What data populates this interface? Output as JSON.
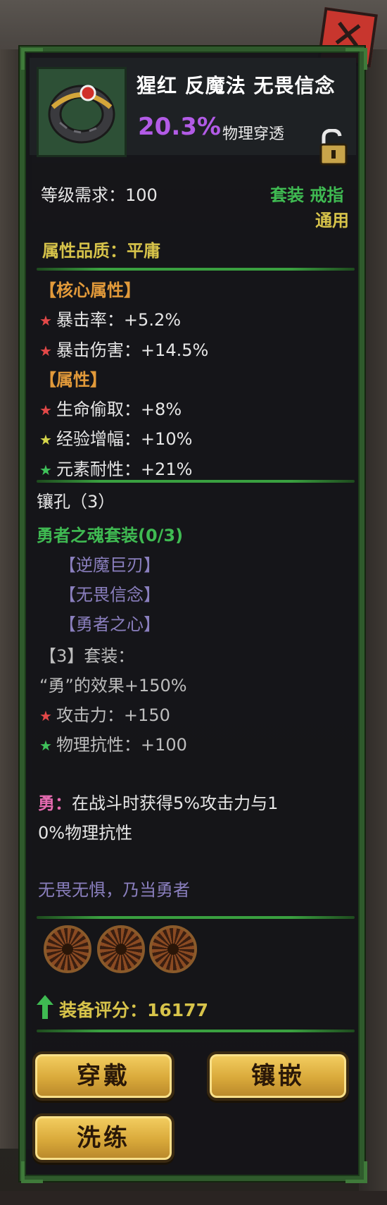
{
  "item": {
    "name": "猩红 反魔法 无畏信念",
    "main_stat_value": "20.3%",
    "main_stat_label": "物理穿透",
    "level_requirement": "等级需求：100",
    "type_label": "套装 戒指",
    "class_label": "通用",
    "quality": "属性品质：平庸"
  },
  "core_section": {
    "header": "【核心属性】",
    "stats": [
      {
        "text": "暴击率：+5.2%",
        "star_color": "#e34848"
      },
      {
        "text": "暴击伤害：+14.5%",
        "star_color": "#e34848"
      }
    ]
  },
  "attr_section": {
    "header": "【属性】",
    "stats": [
      {
        "text": "生命偷取：+8%",
        "star_color": "#e34848"
      },
      {
        "text": "经验增幅：+10%",
        "star_color": "#d6d64a"
      },
      {
        "text": "元素耐性：+21%",
        "star_color": "#3fc25a"
      }
    ]
  },
  "sockets": {
    "label": "镶孔（3）"
  },
  "set_section": {
    "title": "勇者之魂套装(0/3)",
    "pieces": [
      "【逆魔巨刃】",
      "【无畏信念】",
      "【勇者之心】"
    ],
    "bonus_header": "【3】套装：",
    "bonus_effect": "“勇”的效果+150%",
    "bonus_stats": [
      {
        "text": "攻击力：+150",
        "star_color": "#e34848"
      },
      {
        "text": "物理抗性：+100",
        "star_color": "#3fc25a"
      }
    ],
    "effect_name": "勇：",
    "effect_desc_line1": "在战斗时获得5%攻击力与1",
    "effect_desc_line2": "0%物理抗性"
  },
  "flavor_text": "无畏无惧，乃当勇者",
  "score": "装备评分：16177",
  "buttons": {
    "wear": "穿戴",
    "inlay": "镶嵌",
    "refine": "洗练"
  },
  "colors": {
    "panel_border": "#2f5a2c",
    "accent_purple": "#b25be6",
    "accent_gold": "#d7c34a",
    "accent_green": "#3fba52"
  }
}
